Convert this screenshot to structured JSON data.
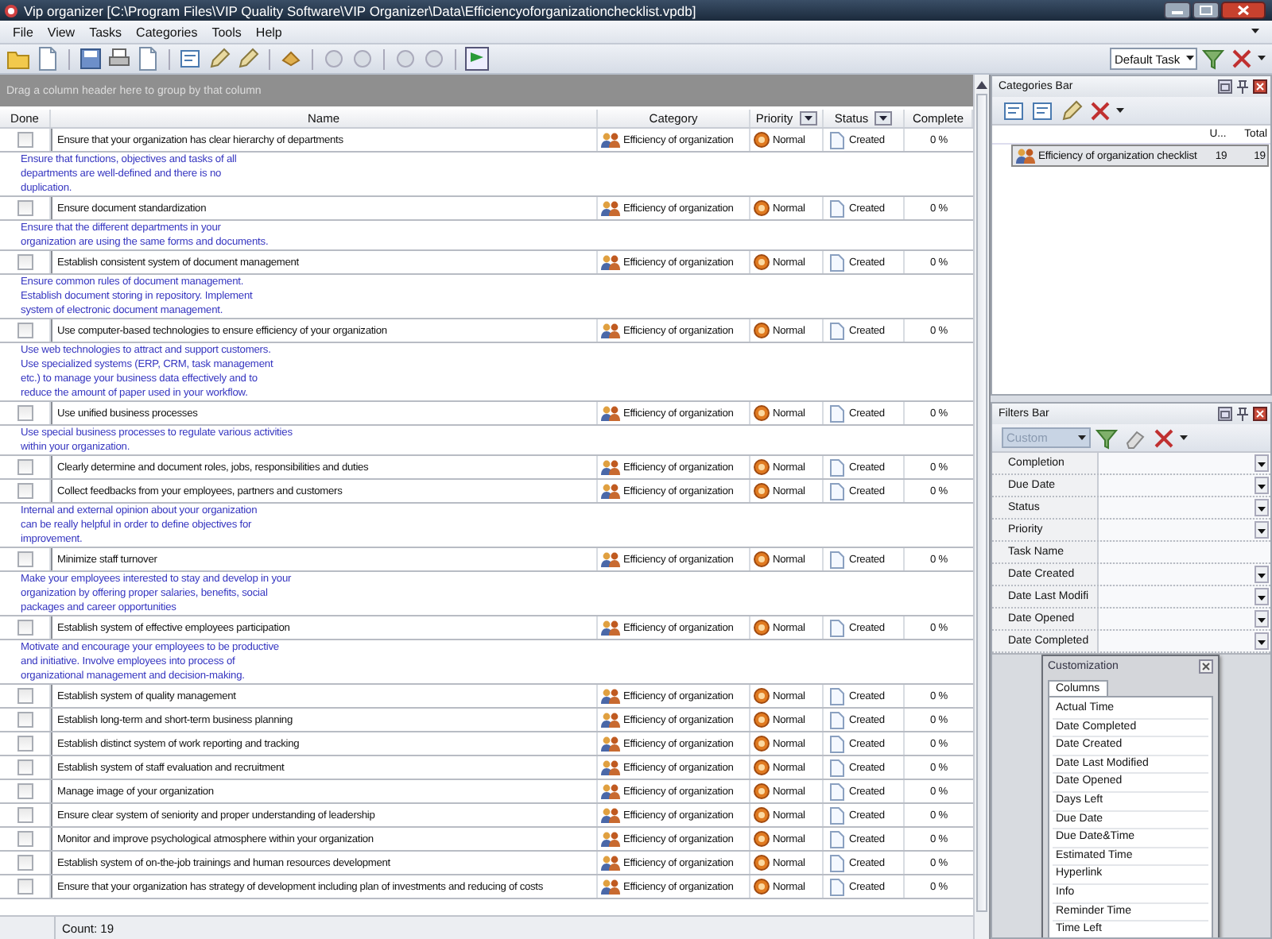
{
  "window": {
    "title": "Vip organizer [C:\\Program Files\\VIP Quality Software\\VIP Organizer\\Data\\Efficiencyoforganizationchecklist.vpdb]"
  },
  "menu": [
    "File",
    "View",
    "Tasks",
    "Categories",
    "Tools",
    "Help"
  ],
  "toolbar": {
    "view_combo": "Default Task"
  },
  "grid": {
    "group_hint": "Drag a column header here to group by that column",
    "columns": [
      {
        "label": "Done",
        "filter_button": false
      },
      {
        "label": "Name",
        "filter_button": false
      },
      {
        "label": "Category",
        "filter_button": false
      },
      {
        "label": "Priority",
        "filter_button": true
      },
      {
        "label": "Status",
        "filter_button": true
      },
      {
        "label": "Complete",
        "filter_button": false
      }
    ],
    "rows": [
      {
        "done": false,
        "name": "Ensure that your organization has clear hierarchy of departments",
        "category": "Efficiency of organization",
        "priority": "Normal",
        "status": "Created",
        "complete": "0 %",
        "note": "Ensure that functions, objectives and tasks of all\ndepartments are well-defined and there is no\nduplication."
      },
      {
        "done": false,
        "name": "Ensure document standardization",
        "category": "Efficiency of organization",
        "priority": "Normal",
        "status": "Created",
        "complete": "0 %",
        "note": "Ensure that the different departments in your\norganization are using the same forms and documents."
      },
      {
        "done": false,
        "name": "Establish consistent system of document management",
        "category": "Efficiency of organization",
        "priority": "Normal",
        "status": "Created",
        "complete": "0 %",
        "note": "Ensure common rules of document management.\nEstablish document storing in repository. Implement\nsystem of electronic document management."
      },
      {
        "done": false,
        "name": "Use computer-based technologies to ensure efficiency of your organization",
        "category": "Efficiency of organization",
        "priority": "Normal",
        "status": "Created",
        "complete": "0 %",
        "note": "Use web technologies to attract and support customers.\nUse specialized systems (ERP, CRM, task management\netc.) to manage your business data effectively and to\nreduce the amount of paper used in your workflow."
      },
      {
        "done": false,
        "name": "Use unified business processes",
        "category": "Efficiency of organization",
        "priority": "Normal",
        "status": "Created",
        "complete": "0 %",
        "note": "Use special business processes to regulate various activities\nwithin your organization."
      },
      {
        "done": false,
        "name": "Clearly determine and document roles, jobs, responsibilities and duties",
        "category": "Efficiency of organization",
        "priority": "Normal",
        "status": "Created",
        "complete": "0 %"
      },
      {
        "done": false,
        "name": "Collect feedbacks from your employees, partners and customers",
        "category": "Efficiency of organization",
        "priority": "Normal",
        "status": "Created",
        "complete": "0 %",
        "note": "Internal and external opinion about your organization\ncan be really helpful in order to define objectives for\nimprovement."
      },
      {
        "done": false,
        "name": "Minimize staff turnover",
        "category": "Efficiency of organization",
        "priority": "Normal",
        "status": "Created",
        "complete": "0 %",
        "note": "Make your employees interested to stay and develop in your\norganization by offering proper salaries, benefits, social\npackages and career opportunities"
      },
      {
        "done": false,
        "name": "Establish system of effective employees participation",
        "category": "Efficiency of organization",
        "priority": "Normal",
        "status": "Created",
        "complete": "0 %",
        "note": "Motivate and encourage your employees to be productive\nand initiative. Involve employees into process of\norganizational management and decision-making."
      },
      {
        "done": false,
        "name": "Establish system of quality management",
        "category": "Efficiency of organization",
        "priority": "Normal",
        "status": "Created",
        "complete": "0 %"
      },
      {
        "done": false,
        "name": "Establish long-term and short-term business planning",
        "category": "Efficiency of organization",
        "priority": "Normal",
        "status": "Created",
        "complete": "0 %"
      },
      {
        "done": false,
        "name": "Establish distinct system of work reporting and tracking",
        "category": "Efficiency of organization",
        "priority": "Normal",
        "status": "Created",
        "complete": "0 %"
      },
      {
        "done": false,
        "name": "Establish system of staff evaluation and recruitment",
        "category": "Efficiency of organization",
        "priority": "Normal",
        "status": "Created",
        "complete": "0 %"
      },
      {
        "done": false,
        "name": "Manage image of your organization",
        "category": "Efficiency of organization",
        "priority": "Normal",
        "status": "Created",
        "complete": "0 %"
      },
      {
        "done": false,
        "name": "Ensure clear system of seniority and proper understanding of leadership",
        "category": "Efficiency of organization",
        "priority": "Normal",
        "status": "Created",
        "complete": "0 %"
      },
      {
        "done": false,
        "name": "Monitor and improve psychological atmosphere within your organization",
        "category": "Efficiency of organization",
        "priority": "Normal",
        "status": "Created",
        "complete": "0 %"
      },
      {
        "done": false,
        "name": "Establish system of on-the-job trainings and human resources development",
        "category": "Efficiency of organization",
        "priority": "Normal",
        "status": "Created",
        "complete": "0 %"
      },
      {
        "done": false,
        "name": "Ensure that your organization has strategy of development including plan of investments and reducing of costs",
        "category": "Efficiency of organization",
        "priority": "Normal",
        "status": "Created",
        "complete": "0 %"
      }
    ],
    "footer": "Count: 19"
  },
  "categories_bar": {
    "title": "Categories Bar",
    "columns": [
      "U...",
      "Total"
    ],
    "items": [
      {
        "name": "Efficiency of organization checklist",
        "unfinished": "19",
        "total": "19",
        "selected": true
      }
    ]
  },
  "filters_bar": {
    "title": "Filters Bar",
    "preset": "Custom",
    "fields": [
      {
        "label": "Completion",
        "dropdown": true
      },
      {
        "label": "Due Date",
        "dropdown": true
      },
      {
        "label": "Status",
        "dropdown": true
      },
      {
        "label": "Priority",
        "dropdown": true
      },
      {
        "label": "Task Name",
        "dropdown": false
      },
      {
        "label": "Date Created",
        "dropdown": true
      },
      {
        "label": "Date Last Modifi",
        "dropdown": true
      },
      {
        "label": "Date Opened",
        "dropdown": true
      },
      {
        "label": "Date Completed",
        "dropdown": true
      }
    ]
  },
  "customization": {
    "title": "Customization",
    "tab": "Columns",
    "items": [
      "Actual Time",
      "Date Completed",
      "Date Created",
      "Date Last Modified",
      "Date Opened",
      "Days Left",
      "Due Date",
      "Due Date&Time",
      "Estimated Time",
      "Hyperlink",
      "Info",
      "Reminder Time",
      "Time Left"
    ]
  }
}
